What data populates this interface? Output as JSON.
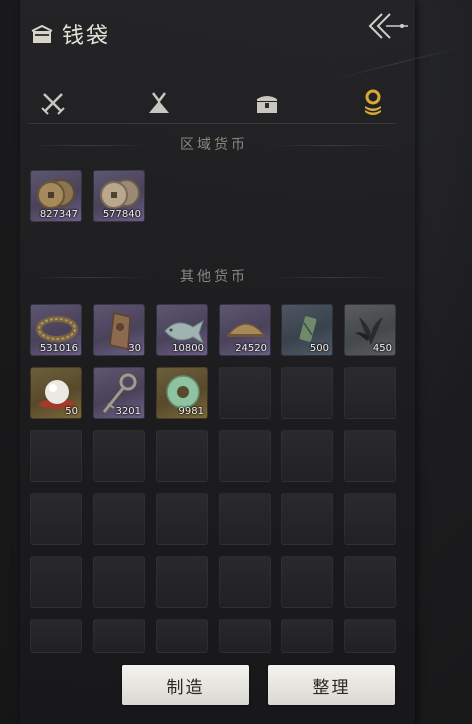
{
  "header": {
    "title": "钱袋",
    "icon": "money-bag-icon"
  },
  "tabs": [
    {
      "name": "weapons",
      "icon": "crossed-swords-icon",
      "active": false
    },
    {
      "name": "bundle",
      "icon": "cloth-bundle-icon",
      "active": false
    },
    {
      "name": "chest",
      "icon": "treasure-chest-icon",
      "active": false
    },
    {
      "name": "currency",
      "icon": "coin-stack-icon",
      "active": true
    }
  ],
  "sections": {
    "regional": {
      "title": "区域货币",
      "items": [
        {
          "icon": "copper-coins-icon",
          "count": "827347",
          "quality": "purple"
        },
        {
          "icon": "copper-coins-icon",
          "count": "577840",
          "quality": "purple"
        }
      ]
    },
    "other": {
      "title": "其他货币",
      "items": [
        {
          "icon": "coin-string-icon",
          "count": "531016",
          "quality": "purple"
        },
        {
          "icon": "bronze-plaque-icon",
          "count": "30",
          "quality": "purple"
        },
        {
          "icon": "jade-fish-icon",
          "count": "10800",
          "quality": "purple"
        },
        {
          "icon": "bronze-bowl-icon",
          "count": "24520",
          "quality": "purple"
        },
        {
          "icon": "jade-token-icon",
          "count": "500",
          "quality": "teal"
        },
        {
          "icon": "dark-herb-icon",
          "count": "450",
          "quality": "gray"
        },
        {
          "icon": "pearl-icon",
          "count": "50",
          "quality": "gold"
        },
        {
          "icon": "coin-sword-icon",
          "count": "3201",
          "quality": "purple"
        },
        {
          "icon": "jade-disc-icon",
          "count": "9981",
          "quality": "gold"
        }
      ]
    }
  },
  "buttons": {
    "craft": "制造",
    "sort": "整理"
  }
}
